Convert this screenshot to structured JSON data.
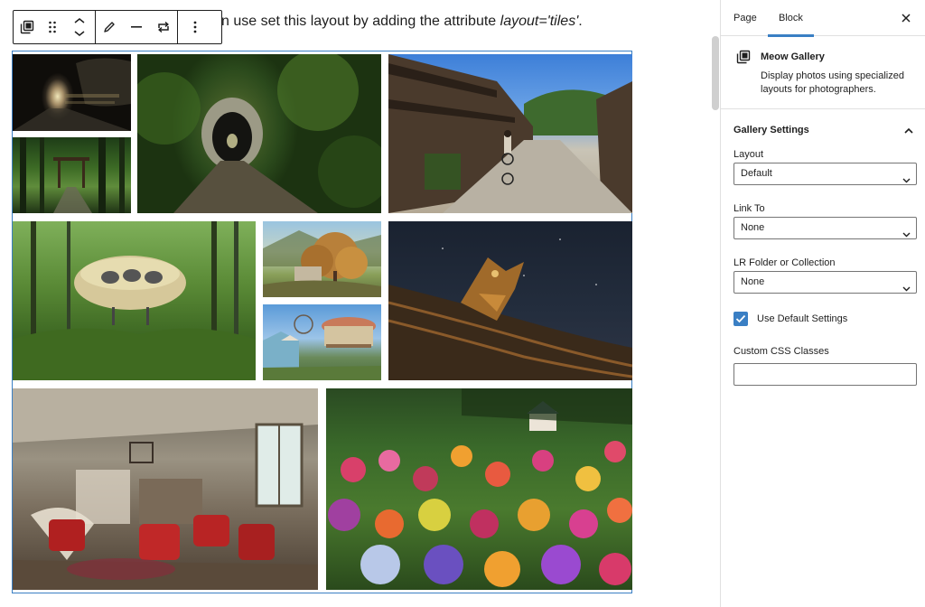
{
  "editor": {
    "intro_text": "n use set this layout by adding the attribute ",
    "intro_code": "layout='tiles'",
    "intro_end": "."
  },
  "toolbar": {
    "icons": [
      "gallery-block-icon",
      "drag-handle-icon",
      "move-arrows-icon",
      "pencil-icon",
      "minus-icon",
      "loop-icon",
      "more-options-icon"
    ]
  },
  "gallery": {
    "tiles": [
      {
        "name": "photo-tunnel-dark"
      },
      {
        "name": "photo-forest-shrine"
      },
      {
        "name": "photo-mossy-tunnel"
      },
      {
        "name": "photo-japanese-street"
      },
      {
        "name": "photo-futuro-house"
      },
      {
        "name": "photo-autumn-tree"
      },
      {
        "name": "photo-amusement-park"
      },
      {
        "name": "photo-dragon-roof"
      },
      {
        "name": "photo-abandoned-room"
      },
      {
        "name": "photo-flower-garden"
      }
    ]
  },
  "sidebar": {
    "tabs": [
      {
        "label": "Page",
        "active": false
      },
      {
        "label": "Block",
        "active": true
      }
    ],
    "block": {
      "title": "Meow Gallery",
      "description": "Display photos using specialized layouts for photographers."
    },
    "panel": {
      "title": "Gallery Settings",
      "layout_label": "Layout",
      "layout_value": "Default",
      "link_label": "Link To",
      "link_value": "None",
      "folder_label": "LR Folder or Collection",
      "folder_value": "None",
      "default_settings_label": "Use Default Settings",
      "default_settings_checked": true,
      "css_label": "Custom CSS Classes",
      "css_value": ""
    }
  },
  "colors": {
    "accent": "#3a7fc4",
    "border": "#e0e0e0",
    "text": "#1e1e1e"
  }
}
